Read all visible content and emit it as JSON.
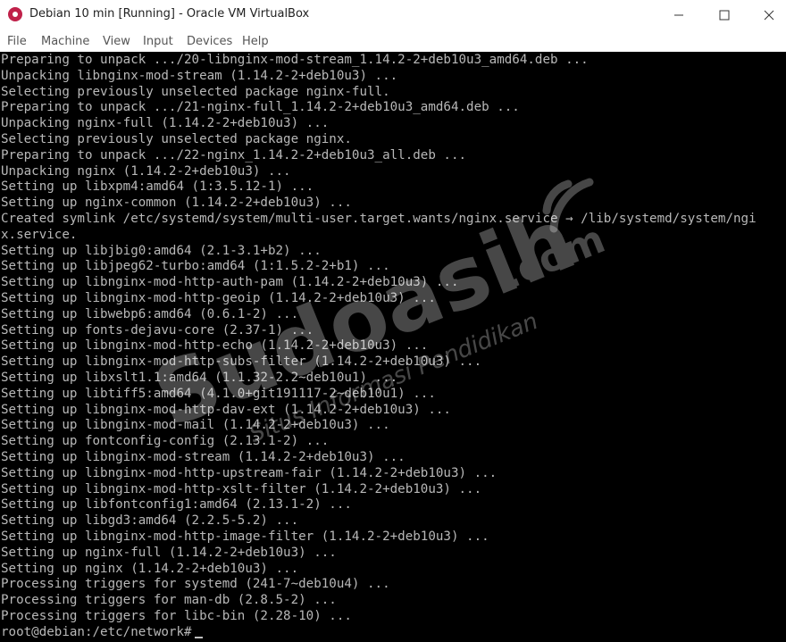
{
  "window": {
    "title": "Debian 10 min [Running] - Oracle VM VirtualBox",
    "app_icon": "virtualbox-icon",
    "controls": {
      "minimize": "—",
      "maximize": "☐",
      "close": "✕"
    }
  },
  "menu": {
    "items": [
      "File",
      "Machine",
      "View",
      "Input",
      "Devices",
      "Help"
    ]
  },
  "terminal": {
    "lines": [
      "Preparing to unpack .../20-libnginx-mod-stream_1.14.2-2+deb10u3_amd64.deb ...",
      "Unpacking libnginx-mod-stream (1.14.2-2+deb10u3) ...",
      "Selecting previously unselected package nginx-full.",
      "Preparing to unpack .../21-nginx-full_1.14.2-2+deb10u3_amd64.deb ...",
      "Unpacking nginx-full (1.14.2-2+deb10u3) ...",
      "Selecting previously unselected package nginx.",
      "Preparing to unpack .../22-nginx_1.14.2-2+deb10u3_all.deb ...",
      "Unpacking nginx (1.14.2-2+deb10u3) ...",
      "Setting up libxpm4:amd64 (1:3.5.12-1) ...",
      "Setting up nginx-common (1.14.2-2+deb10u3) ...",
      "Created symlink /etc/systemd/system/multi-user.target.wants/nginx.service → /lib/systemd/system/ngi",
      "x.service.",
      "Setting up libjbig0:amd64 (2.1-3.1+b2) ...",
      "Setting up libjpeg62-turbo:amd64 (1:1.5.2-2+b1) ...",
      "Setting up libnginx-mod-http-auth-pam (1.14.2-2+deb10u3) ...",
      "Setting up libnginx-mod-http-geoip (1.14.2-2+deb10u3) ...",
      "Setting up libwebp6:amd64 (0.6.1-2) ...",
      "Setting up fonts-dejavu-core (2.37-1) ...",
      "Setting up libnginx-mod-http-echo (1.14.2-2+deb10u3) ...",
      "Setting up libnginx-mod-http-subs-filter (1.14.2-2+deb10u3) ...",
      "Setting up libxslt1.1:amd64 (1.1.32-2.2~deb10u1) ...",
      "Setting up libtiff5:amd64 (4.1.0+git191117-2~deb10u1) ...",
      "Setting up libnginx-mod-http-dav-ext (1.14.2-2+deb10u3) ...",
      "Setting up libnginx-mod-mail (1.14.2-2+deb10u3) ...",
      "Setting up fontconfig-config (2.13.1-2) ...",
      "Setting up libnginx-mod-stream (1.14.2-2+deb10u3) ...",
      "Setting up libnginx-mod-http-upstream-fair (1.14.2-2+deb10u3) ...",
      "Setting up libnginx-mod-http-xslt-filter (1.14.2-2+deb10u3) ...",
      "Setting up libfontconfig1:amd64 (2.13.1-2) ...",
      "Setting up libgd3:amd64 (2.2.5-5.2) ...",
      "Setting up libnginx-mod-http-image-filter (1.14.2-2+deb10u3) ...",
      "Setting up nginx-full (1.14.2-2+deb10u3) ...",
      "Setting up nginx (1.14.2-2+deb10u3) ...",
      "Processing triggers for systemd (241-7~deb10u4) ...",
      "Processing triggers for man-db (2.8.5-2) ...",
      "Processing triggers for libc-bin (2.28-10) ..."
    ],
    "prompt": "root@debian:/etc/network#"
  },
  "watermark": {
    "brand": "Sudoasih",
    "domain": ".com",
    "tagline": "Situs Informasi Pendidikan"
  }
}
